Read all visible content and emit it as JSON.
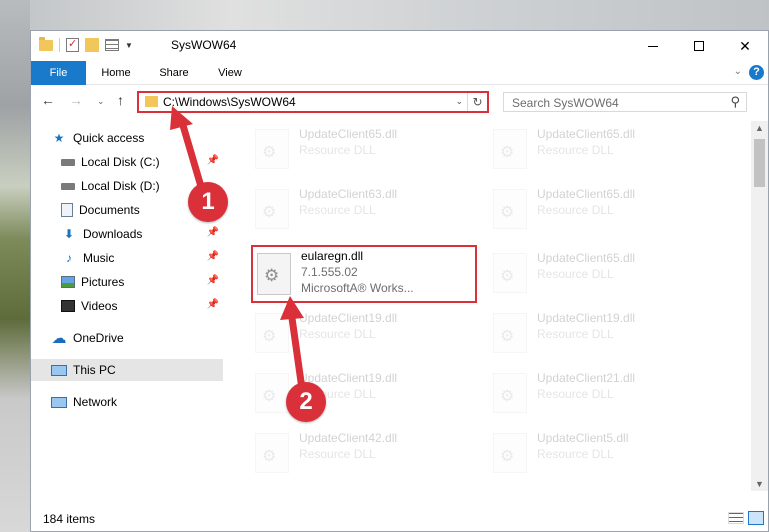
{
  "window": {
    "title": "SysWOW64"
  },
  "ribbon": {
    "tabs": [
      "File",
      "Home",
      "Share",
      "View"
    ]
  },
  "nav": {
    "address": "C:\\Windows\\SysWOW64",
    "search_placeholder": "Search SysWOW64"
  },
  "sidebar": {
    "items": [
      {
        "label": "Quick access",
        "icon": "star-icon",
        "pinned": false
      },
      {
        "label": "Local Disk (C:)",
        "icon": "drive-icon",
        "pinned": true
      },
      {
        "label": "Local Disk (D:)",
        "icon": "drive-icon",
        "pinned": false
      },
      {
        "label": "Documents",
        "icon": "documents-icon",
        "pinned": true
      },
      {
        "label": "Downloads",
        "icon": "downloads-icon",
        "pinned": true
      },
      {
        "label": "Music",
        "icon": "music-icon",
        "pinned": true
      },
      {
        "label": "Pictures",
        "icon": "pictures-icon",
        "pinned": true
      },
      {
        "label": "Videos",
        "icon": "videos-icon",
        "pinned": true
      },
      {
        "label": "OneDrive",
        "icon": "onedrive-icon",
        "pinned": false
      },
      {
        "label": "This PC",
        "icon": "this-pc-icon",
        "pinned": false,
        "selected": true
      },
      {
        "label": "Network",
        "icon": "network-icon",
        "pinned": false
      }
    ]
  },
  "files": {
    "left": [
      {
        "name": "UpdateClient65.dll",
        "type": "Resource DLL"
      },
      {
        "name": "UpdateClient63.dll",
        "type": "Resource DLL"
      },
      {
        "name": "UpdateClient19.dll",
        "type": "Resource DLL"
      },
      {
        "name": "UpdateClient19.dll",
        "type": "Resource DLL"
      },
      {
        "name": "UpdateClient42.dll",
        "type": "Resource DLL"
      }
    ],
    "right": [
      {
        "name": "UpdateClient65.dll",
        "type": "Resource DLL"
      },
      {
        "name": "UpdateClient65.dll",
        "type": "Resource DLL"
      },
      {
        "name": "UpdateClient65.dll",
        "type": "Resource DLL"
      },
      {
        "name": "UpdateClient19.dll",
        "type": "Resource DLL"
      },
      {
        "name": "UpdateClient21.dll",
        "type": "Resource DLL"
      },
      {
        "name": "UpdateClient5.dll",
        "type": "Resource DLL"
      }
    ],
    "highlighted": {
      "name": "eularegn.dll",
      "version": "7.1.555.02",
      "company": "MicrosoftA® Works..."
    }
  },
  "status": {
    "count": "184 items"
  },
  "annotations": {
    "step1": "1",
    "step2": "2",
    "highlight_color": "#d9303a"
  },
  "colors": {
    "accent": "#1979ca",
    "highlight": "#d9303a"
  }
}
